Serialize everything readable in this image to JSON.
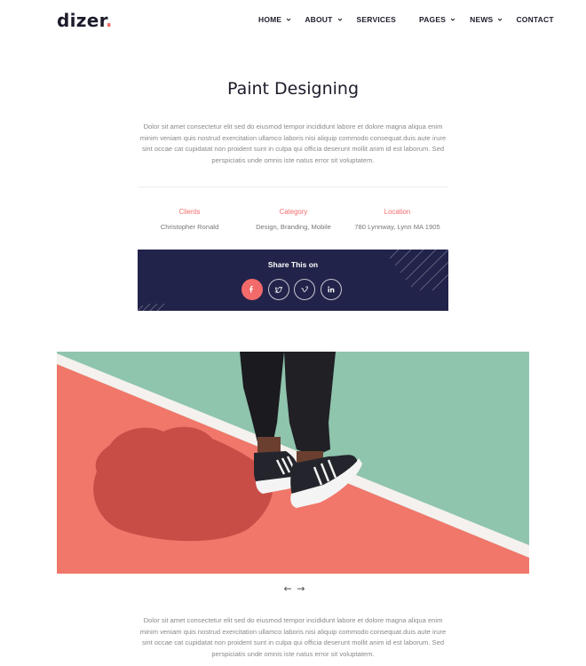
{
  "header": {
    "logo_text": "dizer",
    "logo_dot": ".",
    "nav": [
      {
        "label": "HOME",
        "has_dropdown": true
      },
      {
        "label": "ABOUT",
        "has_dropdown": true
      },
      {
        "label": "SERVICES",
        "has_dropdown": false
      },
      {
        "label": "PAGES",
        "has_dropdown": true
      },
      {
        "label": "NEWS",
        "has_dropdown": true
      },
      {
        "label": "CONTACT",
        "has_dropdown": false
      }
    ]
  },
  "project": {
    "title": "Paint Designing",
    "intro": "Dolor sit amet consectetur elit sed do eiusmod tempor incididunt labore et dolore magna aliqua enim minim veniam quis nostrud exercitation ullamco laboris nisi aliquip commodo consequat.duis aute irure sint occae cat cupidatat non proident sunt in culpa qui officia deserunt mollit anim id est laborum. Sed perspiciatis unde omnis iste natus error sit voluptatem.",
    "meta": [
      {
        "label": "Clients",
        "value": "Christopher Ronald"
      },
      {
        "label": "Category",
        "value": "Design, Branding, Mobile"
      },
      {
        "label": "Location",
        "value": "780 Lynnway, Lynn MA 1905"
      }
    ],
    "share": {
      "title": "Share This on",
      "icons": [
        {
          "name": "facebook-icon",
          "glyph": "f",
          "active": true
        },
        {
          "name": "twitter-icon",
          "glyph": "t",
          "active": false
        },
        {
          "name": "vimeo-icon",
          "glyph": "v",
          "active": false
        },
        {
          "name": "linkedin-icon",
          "glyph": "in",
          "active": false
        }
      ]
    },
    "hero_image": "photo-legs-sneakers-court",
    "slider_prev_icon": "arrow-left-icon",
    "slider_next_icon": "arrow-right-icon",
    "outro": "Dolor sit amet consectetur elit sed do eiusmod tempor incididunt labore et dolore magna aliqua enim minim veniam quis nostrud exercitation ullamco laboris nisi aliquip commodo consequat.duis aute irure sint occae cat cupidatat non proident sunt in culpa qui officia deserunt mollit anim id est laborum. Sed perspiciatis unde omnis iste natus error sit voluptatem."
  },
  "colors": {
    "accent": "#f36a6a",
    "share_bg": "#22234a",
    "text_dark": "#1c1c2b",
    "text_muted": "#8a8a8a"
  }
}
